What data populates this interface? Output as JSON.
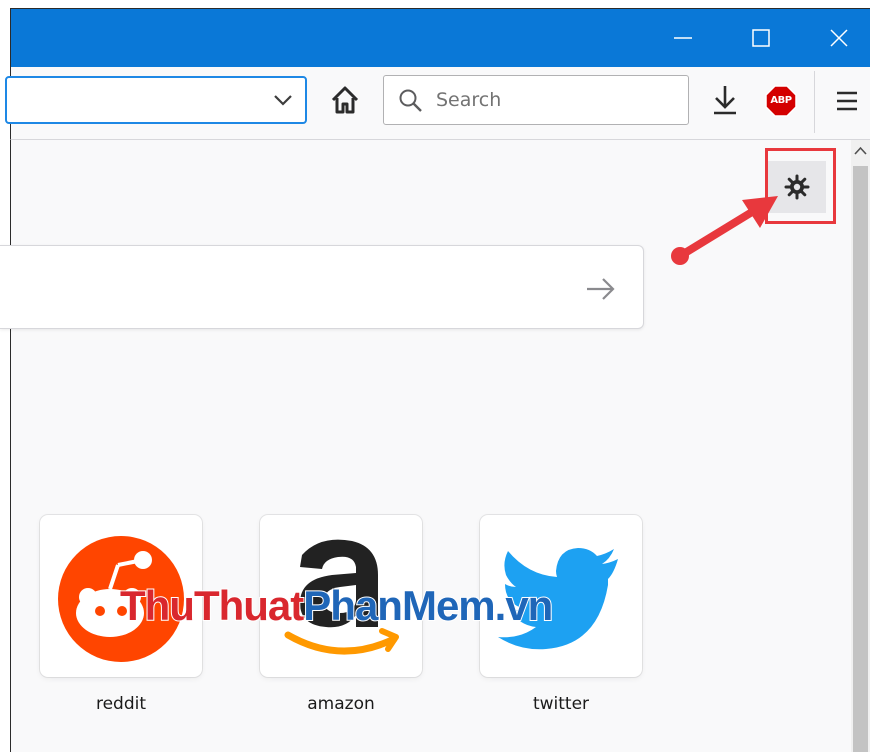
{
  "window": {
    "controls": [
      "minimize",
      "maximize",
      "close"
    ]
  },
  "toolbar": {
    "url_value": "",
    "search_placeholder": "Search",
    "adblock_label": "ABP",
    "icons": [
      "chevron-down-icon",
      "home-icon",
      "search-icon",
      "download-icon",
      "adblock-icon",
      "hamburger-menu-icon"
    ]
  },
  "newtab": {
    "search_value": "",
    "settings_icon": "gear-icon",
    "top_sites": [
      {
        "label": "reddit",
        "color": "#ff4500"
      },
      {
        "label": "amazon",
        "color": "#ff9900"
      },
      {
        "label": "twitter",
        "color": "#1da1f2"
      }
    ]
  },
  "annotations": {
    "highlight_color": "#e8383d",
    "arrow_color": "#e8383d"
  },
  "watermark": {
    "part1": "ThuThuat",
    "part2": "PhanMem",
    "part3": ".vn"
  },
  "colors": {
    "titlebar": "#0a78d7",
    "accent": "#1e88e5",
    "page_bg": "#f9f9fa"
  }
}
